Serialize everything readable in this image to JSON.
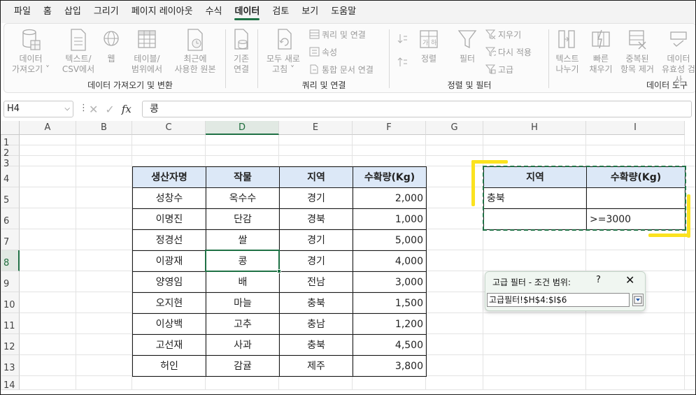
{
  "menu": [
    "파일",
    "홈",
    "삽입",
    "그리기",
    "페이지 레이아웃",
    "수식",
    "데이터",
    "검토",
    "보기",
    "도움말"
  ],
  "menu_active": "데이터",
  "ribbon": {
    "get_data": {
      "label_1": "데이터",
      "label_2": "가져오기 ˅"
    },
    "text_csv": {
      "label_1": "텍스트/",
      "label_2": "CSV에서"
    },
    "web": {
      "label_1": "웹"
    },
    "table_range": {
      "label_1": "테이블/",
      "label_2": "범위에서"
    },
    "recent": {
      "label_1": "최근에",
      "label_2": "사용한 원본"
    },
    "existing": {
      "label_1": "기존",
      "label_2": "연결"
    },
    "group1_label": "데이터 가져오기 및 변환",
    "refresh_all": {
      "label_1": "모두 새로",
      "label_2": "고침 ˅"
    },
    "queries_connections": "쿼리 및 연결",
    "properties": "속성",
    "edit_links": "통합 문서 연결",
    "group2_label": "쿼리 및 연결",
    "sort": "정렬",
    "filter": "필터",
    "clear": "지우기",
    "reapply": "다시 적용",
    "advanced": "고급",
    "group3_label": "정렬 및 필터",
    "text_to_columns": {
      "label_1": "텍스트",
      "label_2": "나누기"
    },
    "flash_fill": {
      "label_1": "빠른",
      "label_2": "채우기"
    },
    "remove_duplicates": {
      "label_1": "중복된",
      "label_2": "항목 제거"
    },
    "data_validation": {
      "label_1": "데이터",
      "label_2": "유효성 검사"
    },
    "group4_label": "데이터 도구"
  },
  "formula_bar": {
    "name_box": "H4",
    "formula": "콩",
    "fx": "fx"
  },
  "columns": [
    "A",
    "B",
    "C",
    "D",
    "E",
    "F",
    "G",
    "H",
    "I"
  ],
  "rows": [
    "1",
    "2",
    "3",
    "4",
    "5",
    "6",
    "7",
    "8",
    "9",
    "10",
    "11",
    "12",
    "13",
    "14"
  ],
  "main_table": {
    "headers": [
      "생산자명",
      "작물",
      "지역",
      "수확량(Kg)"
    ],
    "rows": [
      [
        "성창수",
        "옥수수",
        "경기",
        "2,000"
      ],
      [
        "이명진",
        "단감",
        "경북",
        "1,000"
      ],
      [
        "정경선",
        "쌀",
        "경기",
        "5,000"
      ],
      [
        "이광재",
        "콩",
        "경기",
        "4,000"
      ],
      [
        "양영임",
        "배",
        "전남",
        "3,000"
      ],
      [
        "오지현",
        "마늘",
        "충북",
        "1,500"
      ],
      [
        "이상백",
        "고추",
        "충남",
        "1,200"
      ],
      [
        "고선재",
        "사과",
        "충북",
        "4,500"
      ],
      [
        "허인",
        "감귤",
        "제주",
        "3,800"
      ]
    ]
  },
  "criteria_table": {
    "headers": [
      "지역",
      "수확량(Kg)"
    ],
    "rows": [
      [
        "충북",
        ""
      ],
      [
        "",
        ">=3000"
      ]
    ]
  },
  "dialog": {
    "title": "고급 필터 - 조건 범위:",
    "help": "?",
    "close": "✕",
    "value": "고급필터!$H$4:$I$6"
  }
}
